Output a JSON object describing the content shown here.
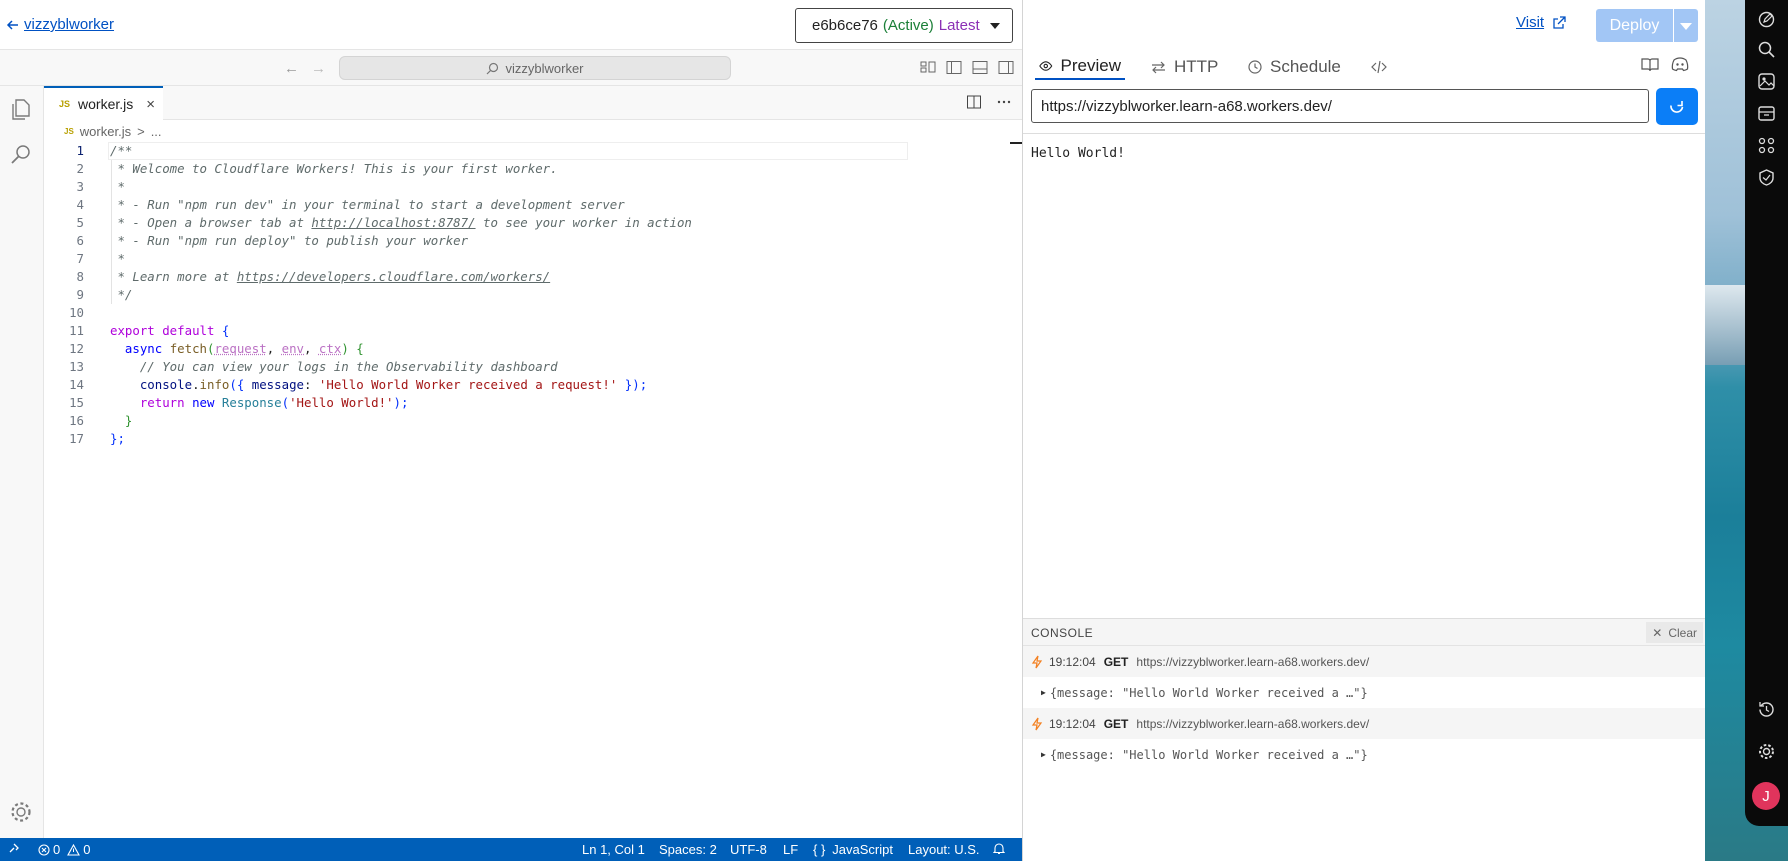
{
  "header": {
    "back_label": "vizzyblworker",
    "version_hash": "e6b6ce76",
    "version_status": "(Active)",
    "version_tag": "Latest"
  },
  "vscode": {
    "command_center": "vizzyblworker",
    "tab": {
      "icon": "JS",
      "label": "worker.js",
      "close": "×"
    },
    "breadcrumb": {
      "icon": "JS",
      "file": "worker.js",
      "separator": ">",
      "more": "..."
    },
    "code_lines": [
      "1",
      "2",
      "3",
      "4",
      "5",
      "6",
      "7",
      "8",
      "9",
      "10",
      "11",
      "12",
      "13",
      "14",
      "15",
      "16",
      "17"
    ],
    "code": {
      "l1": "/**",
      "l2": " * Welcome to Cloudflare Workers! This is your first worker.",
      "l3": " *",
      "l4": " * - Run \"npm run dev\" in your terminal to start a development server",
      "l5a": " * - Open a browser tab at ",
      "l5b": "http://localhost:8787/",
      "l5c": " to see your worker in action",
      "l6": " * - Run \"npm run deploy\" to publish your worker",
      "l7": " *",
      "l8a": " * Learn more at ",
      "l8b": "https://developers.cloudflare.com/workers/",
      "l9": " */",
      "l11a": "export",
      "l11b": " default ",
      "l11c": "{",
      "l12a": "  async ",
      "l12b": "fetch",
      "l12c": "(",
      "l12d": "request",
      "l12e": ", ",
      "l12f": "env",
      "l12g": ", ",
      "l12h": "ctx",
      "l12i": ") ",
      "l12j": "{",
      "l13": "    // You can view your logs in the Observability dashboard",
      "l14a": "    console",
      "l14b": ".",
      "l14c": "info",
      "l14d": "({ ",
      "l14e": "message",
      "l14f": ": ",
      "l14g": "'Hello World Worker received a request!'",
      "l14h": " });",
      "l15a": "    return",
      "l15b": " new ",
      "l15c": "Response",
      "l15d": "(",
      "l15e": "'Hello World!'",
      "l15f": ");",
      "l16": "  }",
      "l17": "};"
    },
    "status": {
      "errors": "0",
      "warnings": "0",
      "position": "Ln 1, Col 1",
      "spaces": "Spaces: 2",
      "encoding": "UTF-8",
      "eol": "LF",
      "language_icon": "{ }",
      "language": "JavaScript",
      "layout": "Layout: U.S."
    }
  },
  "right": {
    "visit_label": "Visit",
    "deploy_label": "Deploy",
    "tabs": {
      "preview": "Preview",
      "http": "HTTP",
      "schedule": "Schedule"
    },
    "url": "https://vizzyblworker.learn-a68.workers.dev/",
    "preview_output": "Hello World!",
    "console": {
      "title": "CONSOLE",
      "clear_label": "Clear",
      "logs": [
        {
          "time": "19:12:04",
          "method": "GET",
          "url": "https://vizzyblworker.learn-a68.workers.dev/",
          "message": "{message: \"Hello World Worker received a …\"}"
        },
        {
          "time": "19:12:04",
          "method": "GET",
          "url": "https://vizzyblworker.learn-a68.workers.dev/",
          "message": "{message: \"Hello World Worker received a …\"}"
        }
      ]
    }
  },
  "dock": {
    "avatar_letter": "J"
  },
  "icons": [
    "arrow-left-icon",
    "chevron-down-icon",
    "search-icon",
    "files-icon",
    "gear-icon",
    "split-editor-icon",
    "more-icon",
    "eye-icon",
    "arrows-icon",
    "clock-icon",
    "code-icon",
    "book-icon",
    "discord-icon",
    "refresh-icon",
    "bolt-icon",
    "external-link-icon",
    "error-icon",
    "warning-icon",
    "bell-icon"
  ],
  "colors": {
    "accent": "#0051c3",
    "status_bar": "#005fb8",
    "deploy_disabled": "#a2c6f5",
    "refresh_button": "#0b7ef7",
    "avatar": "#e0345c"
  }
}
